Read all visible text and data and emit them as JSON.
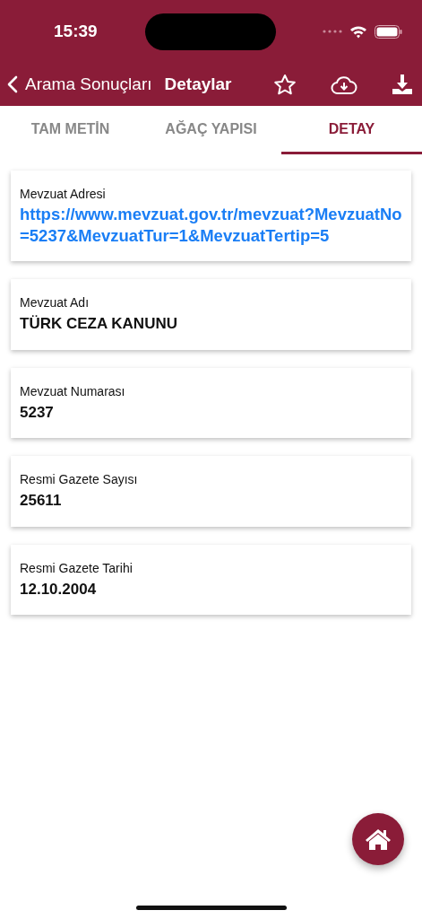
{
  "status_bar": {
    "time": "15:39"
  },
  "nav_bar": {
    "back_label": "Arama Sonuçları",
    "title": "Detaylar"
  },
  "tabs": [
    {
      "label": "TAM METİN",
      "selected": false
    },
    {
      "label": "AĞAÇ YAPISI",
      "selected": false
    },
    {
      "label": "DETAY",
      "selected": true
    }
  ],
  "fields": [
    {
      "label": "Mevzuat Adresi",
      "value": "https://www.mevzuat.gov.tr/mevzuat?MevzuatNo=5237&MevzuatTur=1&MevzuatTertip=5",
      "kind": "link"
    },
    {
      "label": "Mevzuat Adı",
      "value": "TÜRK CEZA KANUNU",
      "kind": "text"
    },
    {
      "label": "Mevzuat Numarası",
      "value": "5237",
      "kind": "text"
    },
    {
      "label": "Resmi Gazete Sayısı",
      "value": "25611",
      "kind": "text"
    },
    {
      "label": "Resmi Gazete Tarihi",
      "value": "12.10.2004",
      "kind": "text"
    }
  ]
}
